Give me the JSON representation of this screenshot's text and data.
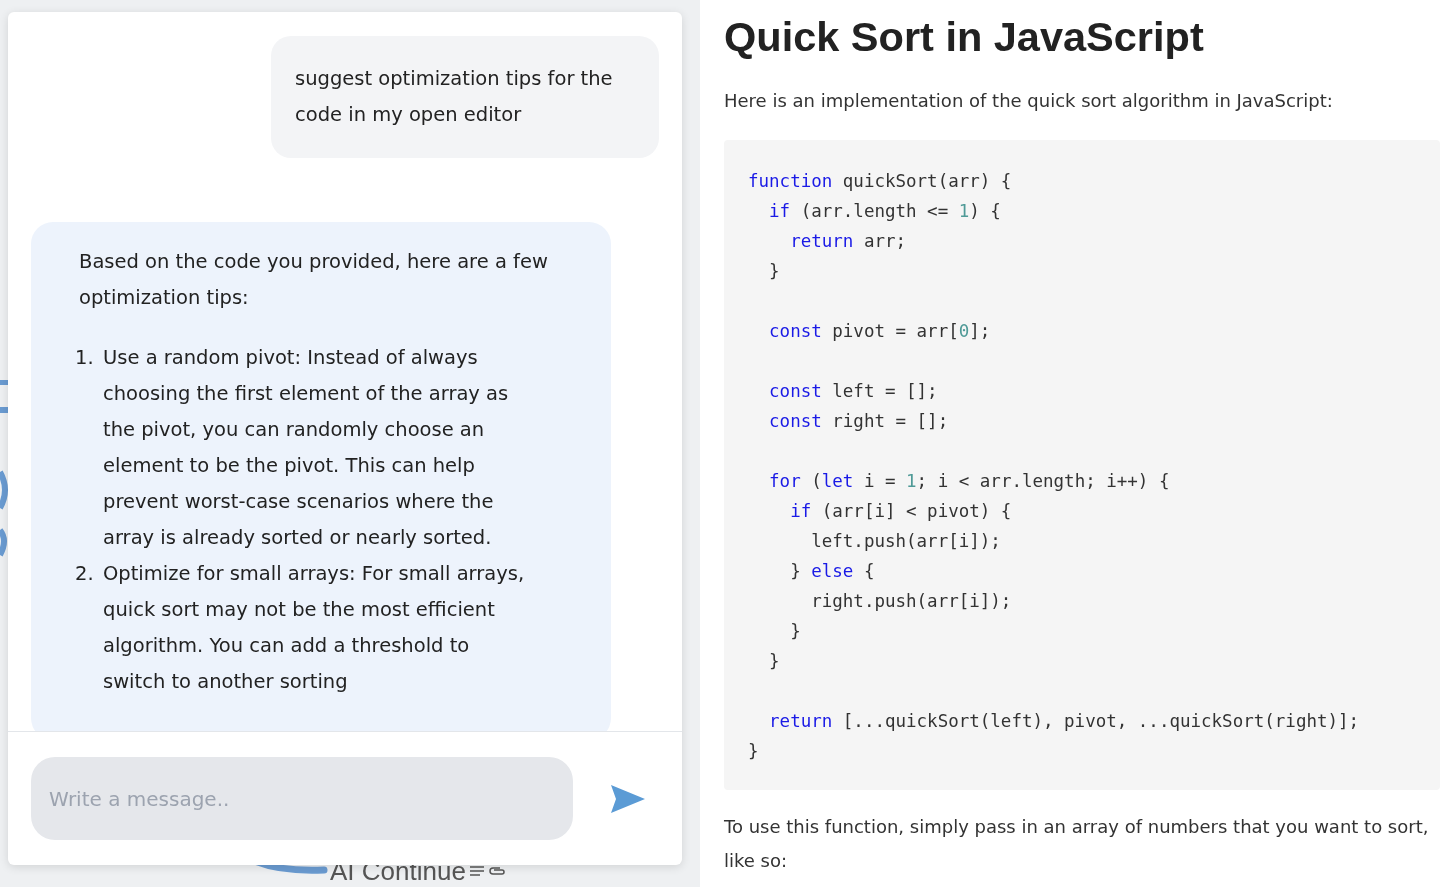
{
  "background": {
    "label": "AI Continue"
  },
  "chat": {
    "messages": [
      {
        "kind": "user",
        "text": "suggest optimization tips for the code in my open editor"
      },
      {
        "kind": "assistant",
        "intro": "Based on the code you provided, here are a few optimization tips:",
        "list": [
          {
            "marker": "1.",
            "text": "Use a random pivot: Instead of always choosing the first element of the array as the pivot, you can randomly choose an element to be the pivot. This can help prevent worst-case scenarios where the array is already sorted or nearly sorted."
          },
          {
            "marker": "2.",
            "text": "Optimize for small arrays: For small arrays, quick sort may not be the most efficient algorithm. You can add a threshold to switch to another sorting"
          }
        ]
      }
    ],
    "input": {
      "placeholder": "Write a message.."
    }
  },
  "document": {
    "title": "Quick Sort in JavaScript",
    "intro": "Here is an implementation of the quick sort algorithm in JavaScript:",
    "code": [
      {
        "gap_before": false,
        "tokens": [
          {
            "kind": "keyword",
            "text": "function"
          },
          {
            "kind": "plain",
            "text": " quickSort(arr) {"
          }
        ]
      },
      {
        "gap_before": false,
        "tokens": [
          {
            "kind": "keyword",
            "text": "  if"
          },
          {
            "kind": "plain",
            "text": " (arr.length <= "
          },
          {
            "kind": "number",
            "text": "1"
          },
          {
            "kind": "plain",
            "text": ") {"
          }
        ]
      },
      {
        "gap_before": false,
        "tokens": [
          {
            "kind": "keyword",
            "text": "    return"
          },
          {
            "kind": "plain",
            "text": " arr;"
          }
        ]
      },
      {
        "gap_before": false,
        "tokens": [
          {
            "kind": "plain",
            "text": "  }"
          }
        ]
      },
      {
        "gap_before": true,
        "tokens": [
          {
            "kind": "keyword",
            "text": "  const"
          },
          {
            "kind": "plain",
            "text": " pivot = arr["
          },
          {
            "kind": "number",
            "text": "0"
          },
          {
            "kind": "plain",
            "text": "];"
          }
        ]
      },
      {
        "gap_before": true,
        "tokens": [
          {
            "kind": "keyword",
            "text": "  const"
          },
          {
            "kind": "plain",
            "text": " left = [];"
          }
        ]
      },
      {
        "gap_before": false,
        "tokens": [
          {
            "kind": "keyword",
            "text": "  const"
          },
          {
            "kind": "plain",
            "text": " right = [];"
          }
        ]
      },
      {
        "gap_before": true,
        "tokens": [
          {
            "kind": "keyword",
            "text": "  for"
          },
          {
            "kind": "plain",
            "text": " ("
          },
          {
            "kind": "keyword",
            "text": "let"
          },
          {
            "kind": "plain",
            "text": " i = "
          },
          {
            "kind": "number",
            "text": "1"
          },
          {
            "kind": "plain",
            "text": "; i < arr.length; i++) {"
          }
        ]
      },
      {
        "gap_before": false,
        "tokens": [
          {
            "kind": "keyword",
            "text": "    if"
          },
          {
            "kind": "plain",
            "text": " (arr[i] < pivot) {"
          }
        ]
      },
      {
        "gap_before": false,
        "tokens": [
          {
            "kind": "plain",
            "text": "      left.push(arr[i]);"
          }
        ]
      },
      {
        "gap_before": false,
        "tokens": [
          {
            "kind": "plain",
            "text": "    } "
          },
          {
            "kind": "keyword",
            "text": "else"
          },
          {
            "kind": "plain",
            "text": " {"
          }
        ]
      },
      {
        "gap_before": false,
        "tokens": [
          {
            "kind": "plain",
            "text": "      right.push(arr[i]);"
          }
        ]
      },
      {
        "gap_before": false,
        "tokens": [
          {
            "kind": "plain",
            "text": "    }"
          }
        ]
      },
      {
        "gap_before": false,
        "tokens": [
          {
            "kind": "plain",
            "text": "  }"
          }
        ]
      },
      {
        "gap_before": true,
        "tokens": [
          {
            "kind": "keyword",
            "text": "  return"
          },
          {
            "kind": "plain",
            "text": " [...quickSort(left), pivot, ...quickSort(right)];"
          }
        ]
      },
      {
        "gap_before": false,
        "tokens": [
          {
            "kind": "plain",
            "text": "}"
          }
        ]
      }
    ],
    "outro": "To use this function, simply pass in an array of numbers that you want to sort, like so:"
  }
}
